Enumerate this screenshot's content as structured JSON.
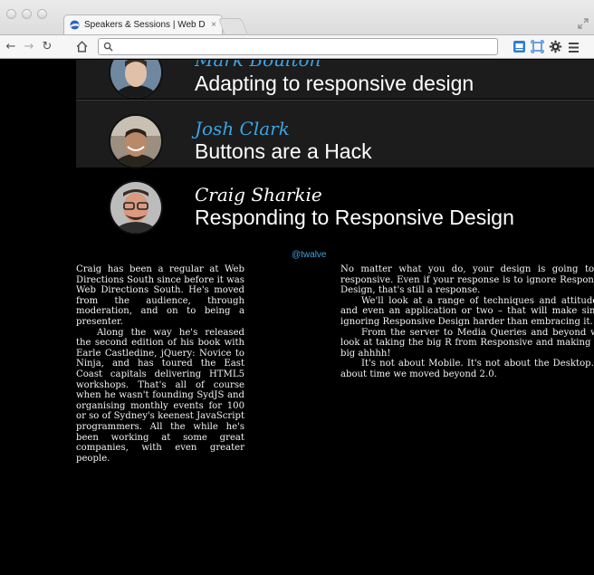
{
  "browser": {
    "tab_title": "Speakers & Sessions | Web D",
    "tab_close": "×",
    "url": "",
    "colors": {
      "accent_blue": "#3ba4e4",
      "page_bg": "#000000"
    }
  },
  "sessions": [
    {
      "speaker": "Mark Boulton",
      "talk": "Adapting to responsive design",
      "speaker_color": "#3ba4e4"
    },
    {
      "speaker": "Josh Clark",
      "talk": "Buttons are a Hack",
      "speaker_color": "#3ba4e4"
    },
    {
      "speaker": "Craig Sharkie",
      "talk": "Responding to Responsive Design",
      "speaker_color": "#ffffff"
    }
  ],
  "twitter_handle": "@twalve",
  "bio": {
    "paragraphs": [
      "Craig has been a regular at Web Directions South since before it was Web Directions South. He's moved from the audience, through moderation, and on to being a presenter.",
      "Along the way he's released the second edition of his book with Earle Castledine, jQuery: Novice to Ninja, and has toured the East Coast capitals delivering HTML5 workshops. That's all of course when he wasn't founding SydJS and organising monthly events for 100 or so of Sydney's keenest JavaScript programmers. All the while he's been working at some great companies, with even greater people."
    ]
  },
  "description": {
    "paragraphs": [
      "No matter what you do, your design is going to be responsive. Even if your response is to ignore Responsive Design, that's still a response.",
      "We'll look at a range of techniques and attitudes – and even an application or two – that will make simply ignoring Responsive Design harder than embracing it.",
      "From the server to Media Queries and beyond we'll look at taking the big R from Responsive and making at a big ahhhh!",
      "It's not about Mobile. It's not about the Desktop. It's about time we moved beyond 2.0."
    ]
  }
}
